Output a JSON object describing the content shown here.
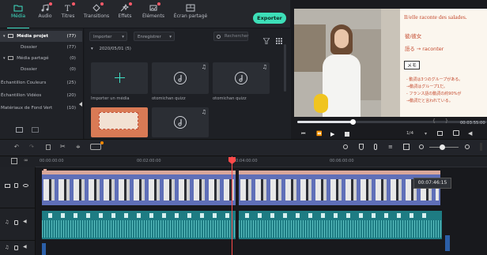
{
  "toolbar": {
    "tabs": [
      {
        "label": "Média",
        "icon": "folder-icon"
      },
      {
        "label": "Audio",
        "icon": "music-note-icon"
      },
      {
        "label": "Titres",
        "icon": "text-icon"
      },
      {
        "label": "Transitions",
        "icon": "transition-icon"
      },
      {
        "label": "Effets",
        "icon": "effects-icon"
      },
      {
        "label": "Éléments",
        "icon": "elements-icon"
      },
      {
        "label": "Écran partagé",
        "icon": "split-screen-icon"
      }
    ],
    "export_label": "Exporter"
  },
  "sidebar": {
    "items": [
      {
        "label": "Média projet",
        "count": "(77)"
      },
      {
        "label": "Dossier",
        "count": "(77)"
      },
      {
        "label": "Média partagé",
        "count": "(0)"
      },
      {
        "label": "Dossier",
        "count": "(0)"
      },
      {
        "label": "Échantillon Couleurs",
        "count": "(25)"
      },
      {
        "label": "Échantillon Vidéos",
        "count": "(20)"
      },
      {
        "label": "Matériaux de Fond Vert",
        "count": "(10)"
      }
    ]
  },
  "library": {
    "import_dropdown": "Importer",
    "record_dropdown": "Enregistrer",
    "search_placeholder": "Rechercher",
    "folder_label": "2020/05/01 (5)",
    "items": [
      {
        "label": "Importer un média"
      },
      {
        "label": "otomichan quizz"
      },
      {
        "label": "otomichan quizz"
      },
      {
        "label": ""
      },
      {
        "label": ""
      }
    ]
  },
  "preview": {
    "slide_title": "Il/elle raconte des salades.",
    "slide_lines": [
      "彼/彼女",
      "語る → raconter"
    ],
    "memo_label": "メモ",
    "memo_lines": [
      "- 動詞は3つのグループがある。",
      "→動詞はグループ1だ。",
      "- フランス語の動詞の約90%が",
      "→動詞だと言われている。"
    ],
    "time_display": "00:03:55:00",
    "zoom_label": "1/4",
    "progress": 0.29
  },
  "timeline": {
    "ruler_labels": [
      "00:00:00:00",
      "00:02:00:00",
      "00:04:00:00",
      "00:06:00:00"
    ],
    "tooltip_time": "00:07:46:15",
    "playhead_position": "00:03:46:00"
  },
  "colors": {
    "accent": "#3ddfb8",
    "video_clip": "#5f6fb8",
    "audio_clip": "#1e7c83",
    "playhead": "#ff4a4a"
  }
}
